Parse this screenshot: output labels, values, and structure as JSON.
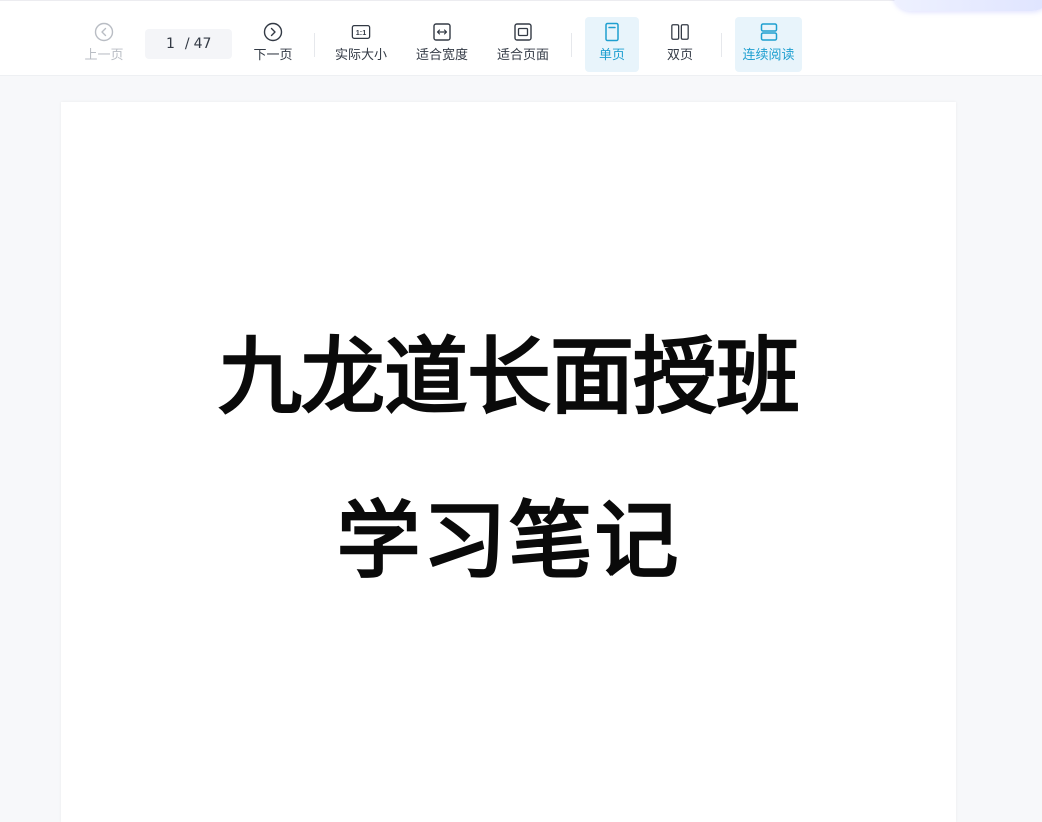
{
  "toolbar": {
    "prev_label": "上一页",
    "next_label": "下一页",
    "page": {
      "current": "1",
      "separator": "/",
      "total": "47"
    },
    "actual_size_label": "实际大小",
    "fit_width_label": "适合宽度",
    "fit_page_label": "适合页面",
    "single_page_label": "单页",
    "double_page_label": "双页",
    "continuous_label": "连续阅读",
    "actual_size_glyph": "1:1",
    "icons": {
      "prev": "chevron-left-circle-icon",
      "next": "chevron-right-circle-icon",
      "actual_size": "one-to-one-icon",
      "fit_width": "fit-width-icon",
      "fit_page": "fit-page-icon",
      "single_page": "single-page-icon",
      "double_page": "double-page-icon",
      "continuous": "continuous-scroll-icon"
    },
    "accent_color": "#1e9fd0",
    "active_bg": "#e8f4fb"
  },
  "document": {
    "title_line1": "九龙道长面授班",
    "title_line2": "学习笔记"
  }
}
